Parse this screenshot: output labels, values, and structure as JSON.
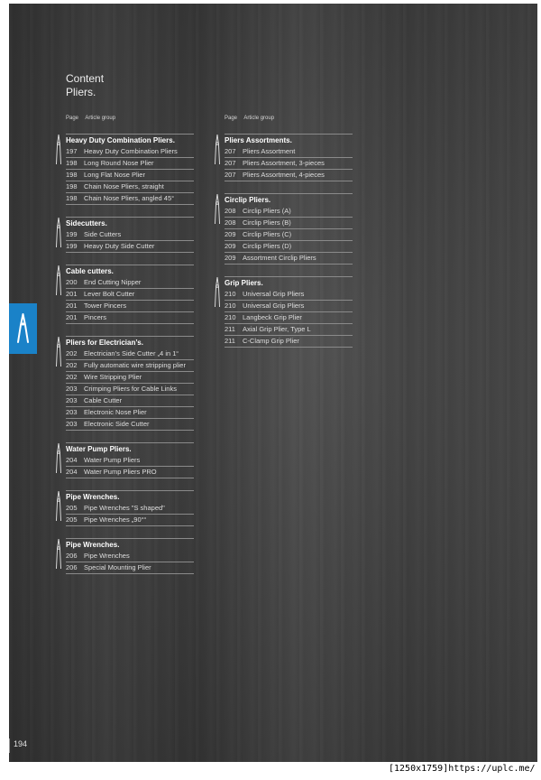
{
  "title": {
    "line1": "Content",
    "line2": "Pliers."
  },
  "column_header": {
    "page": "Page",
    "group": "Article group"
  },
  "page_number": "194",
  "footer": "[1250x1759]https://uplc.me/",
  "left_groups": [
    {
      "title": "Heavy Duty Combination Pliers.",
      "icon": "combination-pliers-icon",
      "items": [
        {
          "page": "197",
          "name": "Heavy Duty Combination Pliers"
        },
        {
          "page": "198",
          "name": "Long Round Nose Plier"
        },
        {
          "page": "198",
          "name": "Long Flat Nose Plier"
        },
        {
          "page": "198",
          "name": "Chain Nose Pliers, straight"
        },
        {
          "page": "198",
          "name": "Chain Nose Pliers, angled 45°"
        }
      ]
    },
    {
      "title": "Sidecutters.",
      "icon": "side-cutter-icon",
      "items": [
        {
          "page": "199",
          "name": "Side Cutters"
        },
        {
          "page": "199",
          "name": "Heavy Duty Side Cutter"
        }
      ]
    },
    {
      "title": "Cable cutters.",
      "icon": "cable-cutter-icon",
      "items": [
        {
          "page": "200",
          "name": "End Cutting Nipper"
        },
        {
          "page": "201",
          "name": "Lever Bolt Cutter"
        },
        {
          "page": "201",
          "name": "Tower Pincers"
        },
        {
          "page": "201",
          "name": "Pincers"
        }
      ]
    },
    {
      "title": "Pliers for Electrician’s.",
      "icon": "electrician-pliers-icon",
      "items": [
        {
          "page": "202",
          "name": "Electrician’s Side Cutter „4 in 1“"
        },
        {
          "page": "202",
          "name": "Fully automatic wire stripping plier"
        },
        {
          "page": "202",
          "name": "Wire Stripping Plier"
        },
        {
          "page": "203",
          "name": "Crimping Pliers for Cable Links"
        },
        {
          "page": "203",
          "name": "Cable Cutter"
        },
        {
          "page": "203",
          "name": "Electronic Nose Plier"
        },
        {
          "page": "203",
          "name": "Electronic Side Cutter"
        }
      ]
    },
    {
      "title": "Water Pump Pliers.",
      "icon": "water-pump-pliers-icon",
      "items": [
        {
          "page": "204",
          "name": "Water Pump Pliers"
        },
        {
          "page": "204",
          "name": "Water Pump Pliers PRO"
        }
      ]
    },
    {
      "title": "Pipe Wrenches.",
      "icon": "pipe-wrench-s-icon",
      "items": [
        {
          "page": "205",
          "name": "Pipe Wrenches \"S shaped\""
        },
        {
          "page": "205",
          "name": "Pipe Wrenches „90°“"
        }
      ]
    },
    {
      "title": "Pipe Wrenches.",
      "icon": "pipe-wrench-icon",
      "items": [
        {
          "page": "206",
          "name": "Pipe Wrenches"
        },
        {
          "page": "206",
          "name": "Special Mounting Plier"
        }
      ]
    }
  ],
  "right_groups": [
    {
      "title": "Pliers Assortments.",
      "icon": "pliers-assortment-icon",
      "items": [
        {
          "page": "207",
          "name": "Pliers Assortment"
        },
        {
          "page": "207",
          "name": "Pliers Assortment, 3-pieces"
        },
        {
          "page": "207",
          "name": "Pliers Assortment, 4-pieces"
        }
      ]
    },
    {
      "title": "Circlip Pliers.",
      "icon": "circlip-pliers-icon",
      "items": [
        {
          "page": "208",
          "name": "Circlip Pliers (A)"
        },
        {
          "page": "208",
          "name": "Circlip Pliers (B)"
        },
        {
          "page": "209",
          "name": "Circlip Pliers (C)"
        },
        {
          "page": "209",
          "name": "Circlip Pliers (D)"
        },
        {
          "page": "209",
          "name": "Assortment Circlip Pliers"
        }
      ]
    },
    {
      "title": "Grip Pliers.",
      "icon": "grip-pliers-icon",
      "items": [
        {
          "page": "210",
          "name": "Universal Grip Pliers"
        },
        {
          "page": "210",
          "name": "Universal Grip Pliers"
        },
        {
          "page": "210",
          "name": "Langbeck Grip Plier"
        },
        {
          "page": "211",
          "name": "Axial Grip Plier, Type L"
        },
        {
          "page": "211",
          "name": "C-Clamp Grip Plier"
        }
      ]
    }
  ],
  "tab_icon": "pliers-icon",
  "colors": {
    "tab": "#1a82c8",
    "background": "#404040",
    "text": "#ffffff"
  }
}
